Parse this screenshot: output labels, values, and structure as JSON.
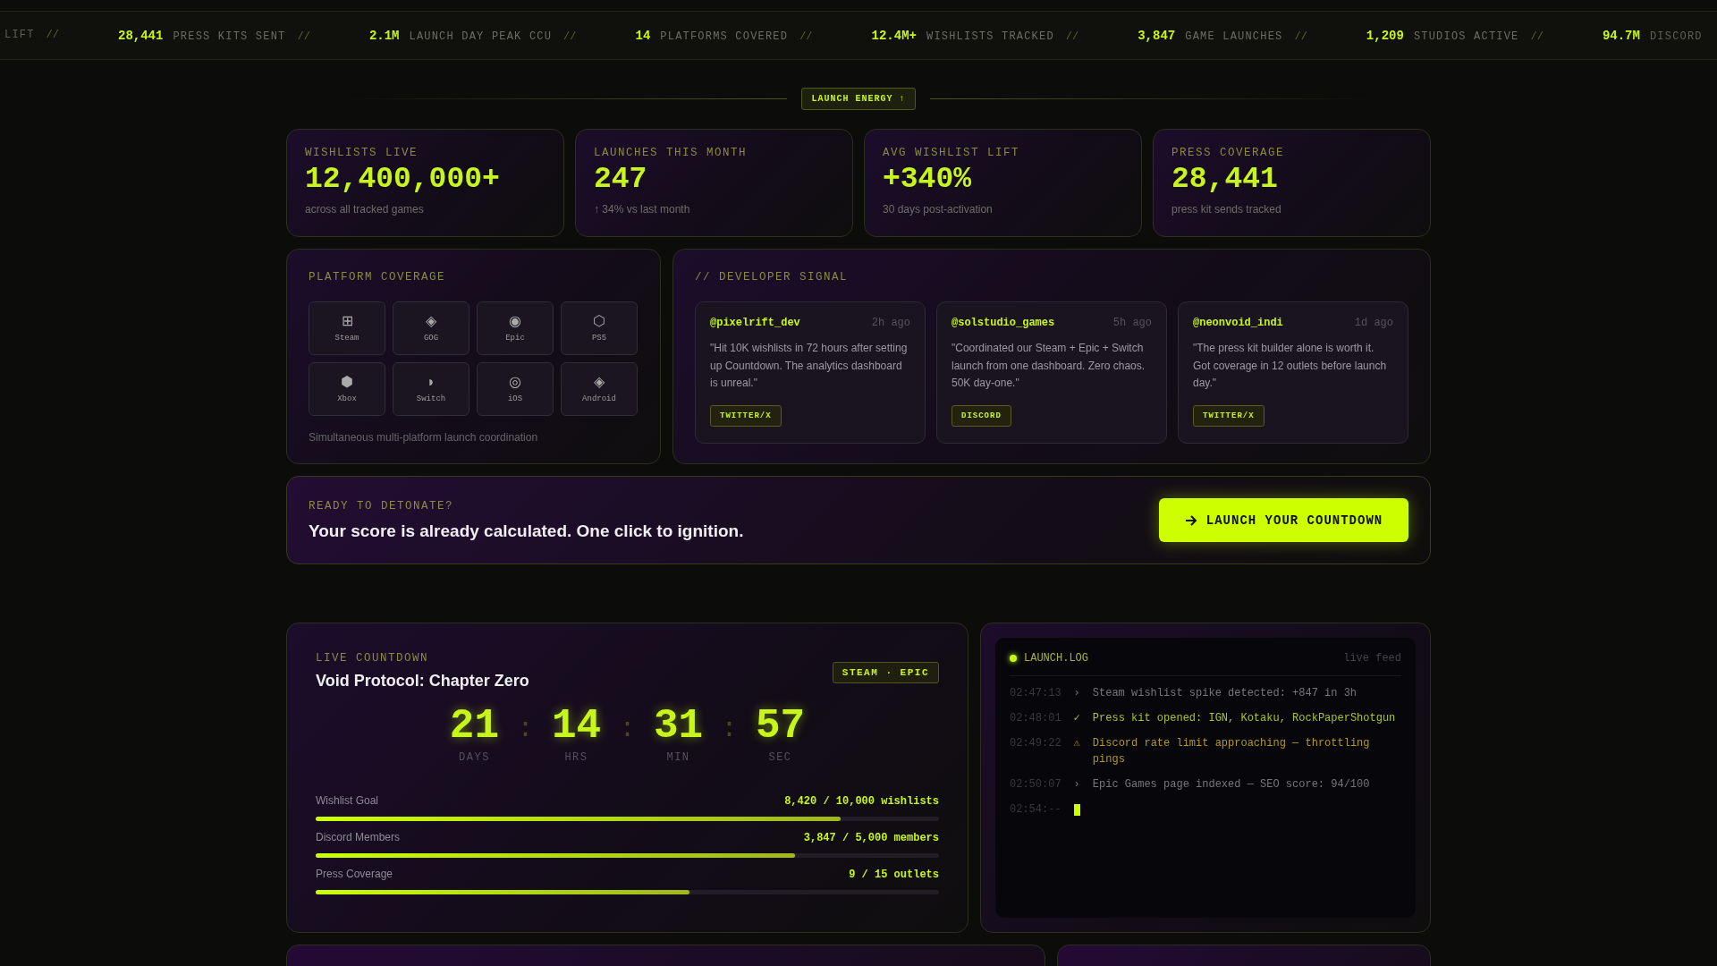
{
  "ticker": [
    {
      "label": "LIFT",
      "sep": "//"
    },
    {
      "value": "28,441",
      "label": "PRESS KITS SENT",
      "sep": "//"
    },
    {
      "value": "2.1M",
      "label": "LAUNCH DAY PEAK CCU",
      "sep": "//"
    },
    {
      "value": "14",
      "label": "PLATFORMS COVERED",
      "sep": "//"
    },
    {
      "value": "12.4M+",
      "label": "WISHLISTS TRACKED",
      "sep": "//"
    },
    {
      "value": "3,847",
      "label": "GAME LAUNCHES",
      "sep": "//"
    },
    {
      "value": "1,209",
      "label": "STUDIOS ACTIVE",
      "sep": "//"
    },
    {
      "value": "94.7M",
      "label": "DISCORD"
    }
  ],
  "section_badge": "LAUNCH ENERGY ↑",
  "stats": [
    {
      "label": "WISHLISTS LIVE",
      "value": "12,400,000+",
      "note": "across all tracked games"
    },
    {
      "label": "LAUNCHES THIS MONTH",
      "value": "247",
      "note": "↑ 34% vs last month"
    },
    {
      "label": "AVG WISHLIST LIFT",
      "value": "+340%",
      "note": "30 days post-activation"
    },
    {
      "label": "PRESS COVERAGE",
      "value": "28,441",
      "note": "press kit sends tracked"
    }
  ],
  "platform_coverage": {
    "title": "PLATFORM COVERAGE",
    "platforms": [
      {
        "icon": "⊞",
        "name": "Steam"
      },
      {
        "icon": "◈",
        "name": "GOG"
      },
      {
        "icon": "◉",
        "name": "Epic"
      },
      {
        "icon": "⬡",
        "name": "PS5"
      },
      {
        "icon": "⬢",
        "name": "Xbox"
      },
      {
        "icon": "◗",
        "name": "Switch"
      },
      {
        "icon": "◎",
        "name": "iOS"
      },
      {
        "icon": "◈",
        "name": "Android"
      }
    ],
    "footer": "Simultaneous multi-platform launch coordination"
  },
  "developer_signal": {
    "title": "// DEVELOPER SIGNAL",
    "posts": [
      {
        "handle": "@pixelrift_dev",
        "time": "2h ago",
        "quote": "\"Hit 10K wishlists in 72 hours after setting up Countdown. The analytics dashboard is unreal.\"",
        "source": "TWITTER/X"
      },
      {
        "handle": "@solstudio_games",
        "time": "5h ago",
        "quote": "\"Coordinated our Steam + Epic + Switch launch from one dashboard. Zero chaos. 50K day-one.\"",
        "source": "DISCORD"
      },
      {
        "handle": "@neonvoid_indi",
        "time": "1d ago",
        "quote": "\"The press kit builder alone is worth it. Got coverage in 12 outlets before launch day.\"",
        "source": "TWITTER/X"
      }
    ]
  },
  "cta": {
    "label": "READY TO DETONATE?",
    "headline": "Your score is already calculated. One click to ignition.",
    "button": "LAUNCH YOUR COUNTDOWN"
  },
  "countdown": {
    "label": "LIVE COUNTDOWN",
    "title": "Void Protocol: Chapter Zero",
    "badge": "STEAM · EPIC",
    "separator": ":",
    "units": [
      {
        "value": "21",
        "unit": "DAYS"
      },
      {
        "value": "14",
        "unit": "HRS"
      },
      {
        "value": "31",
        "unit": "MIN"
      },
      {
        "value": "57",
        "unit": "SEC"
      }
    ],
    "goals": [
      {
        "name": "Wishlist Goal",
        "reading": "8,420 / 10,000 wishlists",
        "level": 0.842
      },
      {
        "name": "Discord Members",
        "reading": "3,847 / 5,000 members",
        "level": 0.769
      },
      {
        "name": "Press Coverage",
        "reading": "9 / 15 outlets",
        "level": 0.6
      }
    ]
  },
  "launch_log": {
    "title": "LAUNCH.LOG",
    "status": "live feed",
    "entries": [
      {
        "time": "02:47:13",
        "kind": "info",
        "mark": "›",
        "text": "Steam wishlist spike detected: +847 in 3h"
      },
      {
        "time": "02:48:01",
        "kind": "success",
        "mark": "✓",
        "text": "Press kit opened: IGN, Kotaku, RockPaperShotgun"
      },
      {
        "time": "02:49:22",
        "kind": "warning",
        "mark": "⚠",
        "text": "Discord rate limit approaching — throttling pings"
      },
      {
        "time": "02:50:07",
        "kind": "info",
        "mark": "›",
        "text": "Epic Games page indexed — SEO score: 94/100"
      },
      {
        "time": "02:54:--",
        "kind": "cursor"
      }
    ]
  }
}
